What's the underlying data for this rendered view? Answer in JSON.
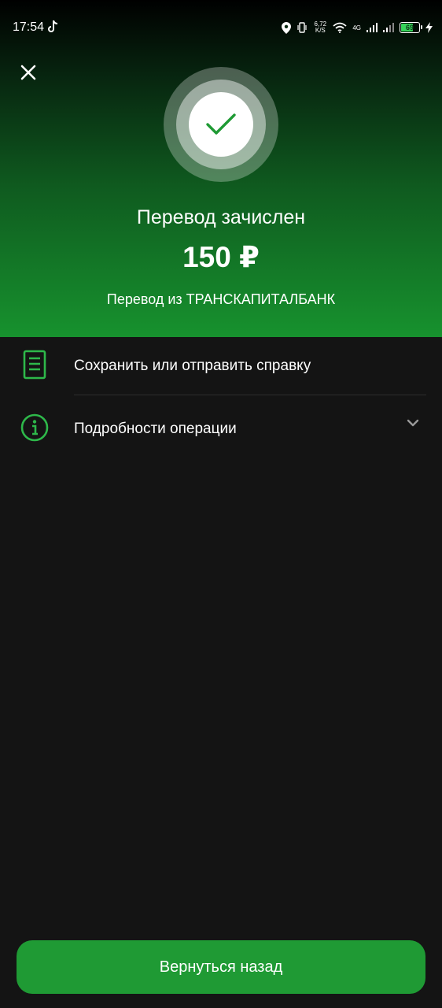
{
  "status_bar": {
    "time": "17:54",
    "net_speed_value": "6,72",
    "net_speed_unit": "K/S",
    "network_type": "4G",
    "battery": "69",
    "battery_level": 0.69,
    "icons": [
      "tiktok-icon",
      "location-icon",
      "vibrate-icon",
      "wifi-icon",
      "signal-icon",
      "signal-icon",
      "charging-icon"
    ]
  },
  "header": {
    "close_icon": "close-icon",
    "success_icon": "checkmark-icon"
  },
  "transfer": {
    "title": "Перевод зачислен",
    "amount": "150 ₽",
    "source": "Перевод из ТРАНСКАПИТАЛБАНК"
  },
  "actions": [
    {
      "label": "Сохранить или отправить справку",
      "icon": "document-icon"
    },
    {
      "label": "Подробности операции",
      "icon": "info-icon",
      "expand_icon": "chevron-down-icon"
    }
  ],
  "footer": {
    "back_label": "Вернуться назад"
  },
  "colors": {
    "accent": "#1f9a34",
    "icon_green": "#2eb84a",
    "background": "#141414"
  }
}
